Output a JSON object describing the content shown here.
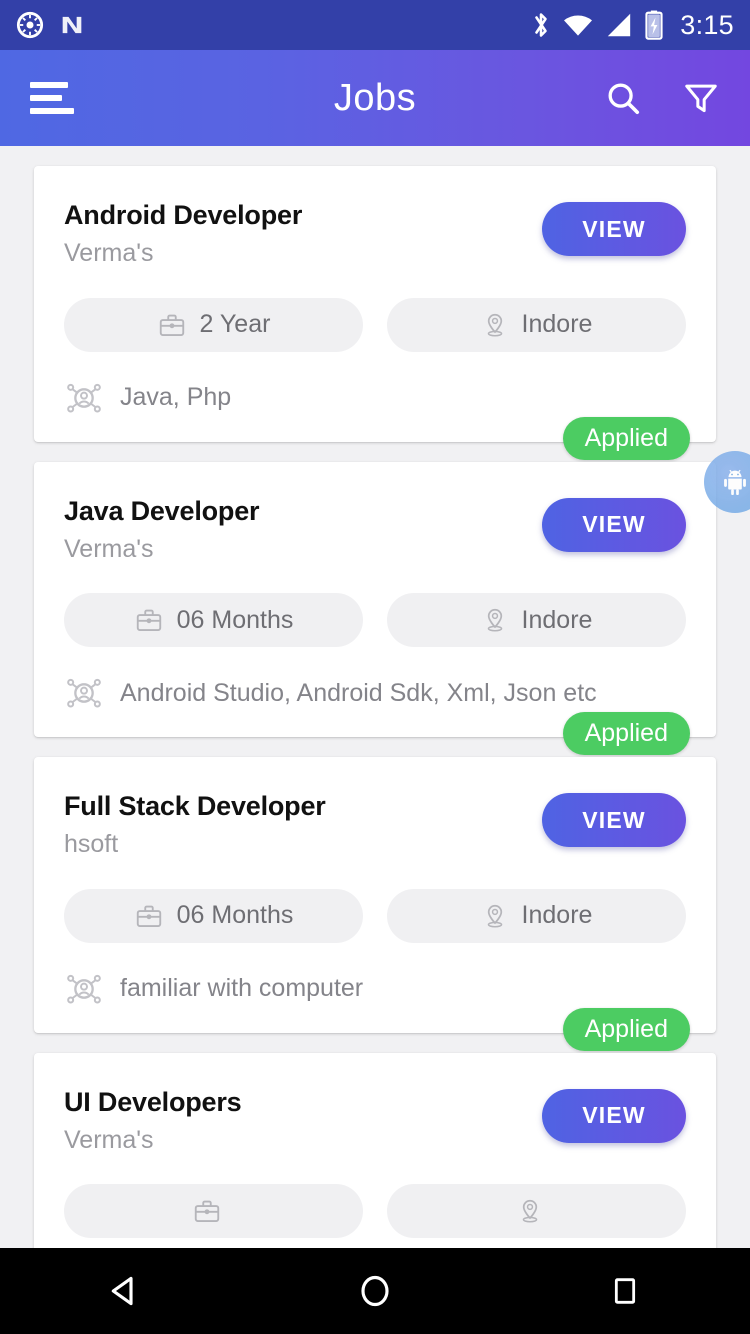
{
  "status_bar": {
    "time": "3:15",
    "left_icons": [
      "clock-icon",
      "android-nougat-icon"
    ],
    "right_icons": [
      "bluetooth-icon",
      "wifi-icon",
      "cellular-signal-icon",
      "battery-charging-icon"
    ],
    "background": "#3340a8"
  },
  "app_bar": {
    "title": "Jobs",
    "menu_icon": "hamburger-menu-icon",
    "search_icon": "search-icon",
    "filter_icon": "filter-icon",
    "gradient_start": "#4f68e3",
    "gradient_end": "#7347e0"
  },
  "floating_bubble": {
    "icon": "android-robot-icon",
    "color": "#6fa8e0"
  },
  "jobs": [
    {
      "title": "Android Developer",
      "company": "Verma's",
      "experience": "2 Year",
      "location": "Indore",
      "skills": "Java, Php",
      "view_label": "VIEW",
      "status": "Applied"
    },
    {
      "title": "Java Developer",
      "company": "Verma's",
      "experience": "06 Months",
      "location": "Indore",
      "skills": "Android Studio, Android Sdk, Xml, Json etc",
      "view_label": "VIEW",
      "status": "Applied"
    },
    {
      "title": "Full Stack Developer",
      "company": "hsoft",
      "experience": "06 Months",
      "location": "Indore",
      "skills": "familiar with computer",
      "view_label": "VIEW",
      "status": "Applied"
    },
    {
      "title": "UI Developers",
      "company": "Verma's",
      "experience": "",
      "location": "",
      "skills": "",
      "view_label": "VIEW",
      "status": ""
    }
  ],
  "colors": {
    "page_background": "#f1f1f3",
    "card_background": "#ffffff",
    "chip_background": "#f0f0f2",
    "applied_badge": "#4ccc62",
    "accent_blue": "#4f63e3",
    "accent_purple": "#6a52e0"
  },
  "nav_bar": {
    "back_label": "back-button",
    "home_label": "home-button",
    "recents_label": "recents-button"
  }
}
